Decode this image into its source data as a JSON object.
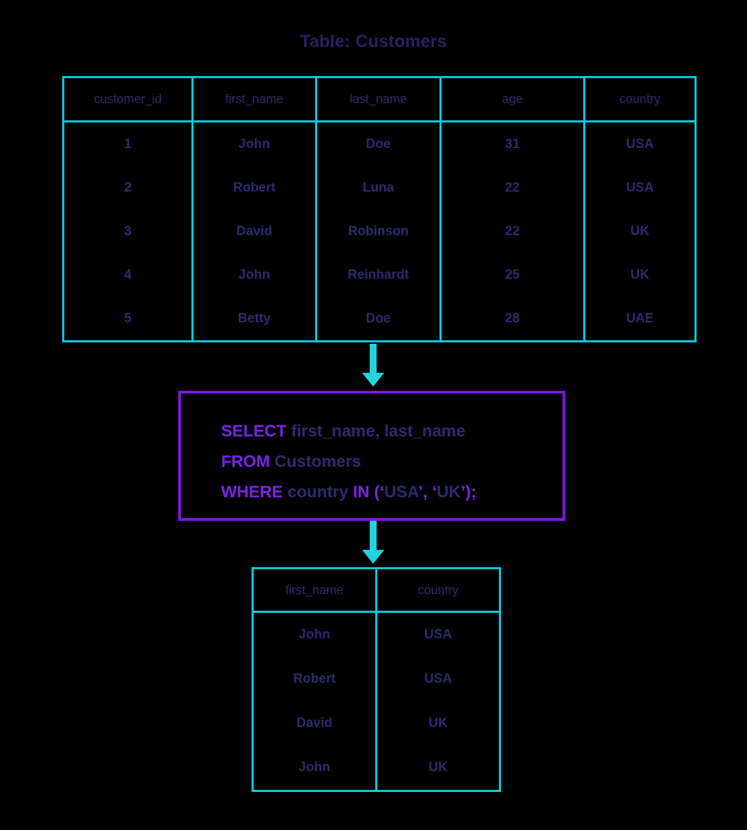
{
  "title": "Table: Customers",
  "colors": {
    "table_border": "#00cfe0",
    "arrow": "#22d3e0",
    "query_border": "#7a18e0",
    "keyword": "#7b22e8",
    "text": "#2b2d6e"
  },
  "source_table": {
    "name": "Customers",
    "columns": [
      "customer_id",
      "first_name",
      "last_name",
      "age",
      "country"
    ],
    "rows": [
      [
        "1",
        "John",
        "Doe",
        "31",
        "USA"
      ],
      [
        "2",
        "Robert",
        "Luna",
        "22",
        "USA"
      ],
      [
        "3",
        "David",
        "Robinson",
        "22",
        "UK"
      ],
      [
        "4",
        "John",
        "Reinhardt",
        "25",
        "UK"
      ],
      [
        "5",
        "Betty",
        "Doe",
        "28",
        "UAE"
      ]
    ]
  },
  "query": {
    "line1": {
      "keyword": "SELECT",
      "rest": " first_name, last_name"
    },
    "line2": {
      "keyword": "FROM",
      "rest": " Customers"
    },
    "line3": {
      "keyword": "WHERE",
      "column": " country ",
      "operator": "IN",
      "open": " (‘",
      "value1": "USA",
      "separator": "’, ‘",
      "value2": "UK",
      "close": "’);"
    },
    "full_text": "SELECT first_name, last_name FROM Customers WHERE country IN (‘USA’, ‘UK’);"
  },
  "result_table": {
    "columns": [
      "first_name",
      "country"
    ],
    "rows": [
      [
        "John",
        "USA"
      ],
      [
        "Robert",
        "USA"
      ],
      [
        "David",
        "UK"
      ],
      [
        "John",
        "UK"
      ]
    ]
  }
}
